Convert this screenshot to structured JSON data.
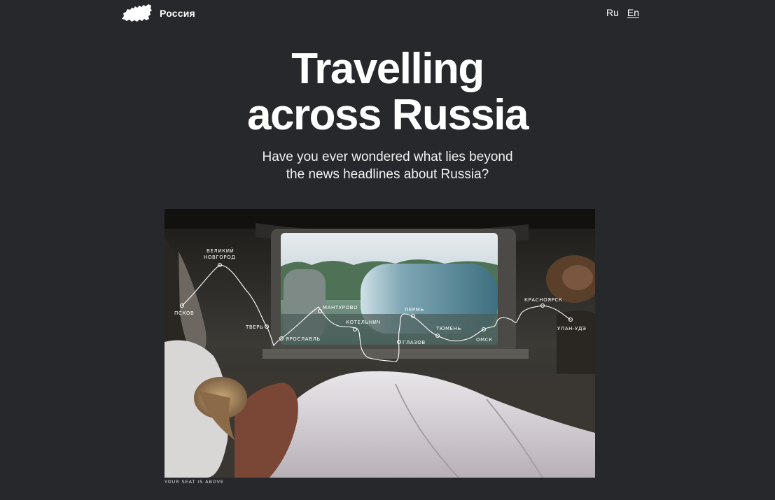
{
  "header": {
    "logo_text": "Россия",
    "logo_icon": "russia-map-icon",
    "languages": [
      {
        "label": "Ru",
        "active": false
      },
      {
        "label": "En",
        "active": true
      }
    ]
  },
  "hero": {
    "title_line1": "Travelling",
    "title_line2": "across Russia",
    "subtitle_line1": "Have you ever wondered what lies beyond",
    "subtitle_line2": "the news headlines about Russia?"
  },
  "photo": {
    "caption": "YOUR SEAT IS ABOVE",
    "route_stops": [
      {
        "name": "ПСКОВ"
      },
      {
        "name": "ВЕЛИКИЙ"
      },
      {
        "name": "НОВГОРОД"
      },
      {
        "name": "ТВЕРЬ"
      },
      {
        "name": "ЯРОСЛАВЛЬ"
      },
      {
        "name": "МАНТУРОВО"
      },
      {
        "name": "КОТЕЛЬНИЧ"
      },
      {
        "name": "ГЛАЗОВ"
      },
      {
        "name": "ПЕРМЬ"
      },
      {
        "name": "ТЮМЕНЬ"
      },
      {
        "name": "ОМСК"
      },
      {
        "name": "КРАСНОЯРСК"
      },
      {
        "name": "УЛАН-УДЭ"
      }
    ]
  }
}
